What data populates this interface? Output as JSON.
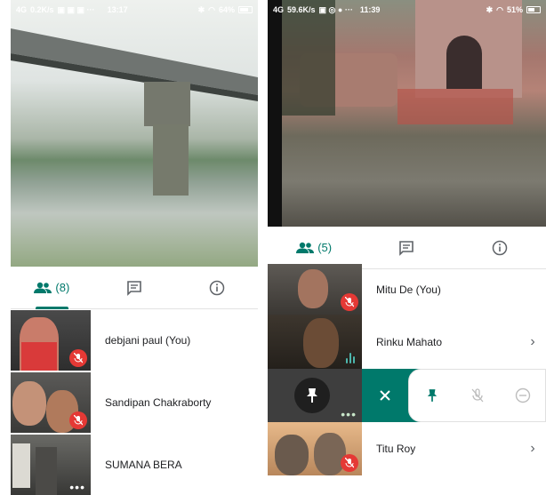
{
  "left_phone": {
    "status": {
      "network": "4G",
      "speed": "0.2K/s",
      "time": "13:17",
      "battery": "64%"
    },
    "tabs": [
      {
        "icon": "people-icon",
        "label": "(8)",
        "active": true
      },
      {
        "icon": "chat-icon",
        "label": ""
      },
      {
        "icon": "info-icon",
        "label": ""
      }
    ],
    "participants": [
      {
        "name": "debjani paul (You)",
        "muted": true
      },
      {
        "name": "Sandipan Chakraborty",
        "muted": true
      },
      {
        "name": "SUMANA BERA",
        "muted": false,
        "more": true
      }
    ]
  },
  "right_phone": {
    "status": {
      "network": "4G",
      "speed": "59.6K/s",
      "time": "11:39",
      "battery": "51%"
    },
    "tabs": [
      {
        "icon": "people-icon",
        "label": "(5)",
        "active": true
      },
      {
        "icon": "chat-icon",
        "label": ""
      },
      {
        "icon": "info-icon",
        "label": ""
      }
    ],
    "participants": [
      {
        "name": "Mitu De (You)",
        "muted": true
      },
      {
        "name": "Rinku Mahato",
        "speaking": true
      },
      {
        "name": "Titu Roy",
        "muted": true
      }
    ],
    "pin_menu": {
      "actions": [
        "close",
        "pin",
        "mute",
        "remove"
      ]
    }
  },
  "colors": {
    "accent": "#00796b",
    "muted_red": "#e53935"
  }
}
